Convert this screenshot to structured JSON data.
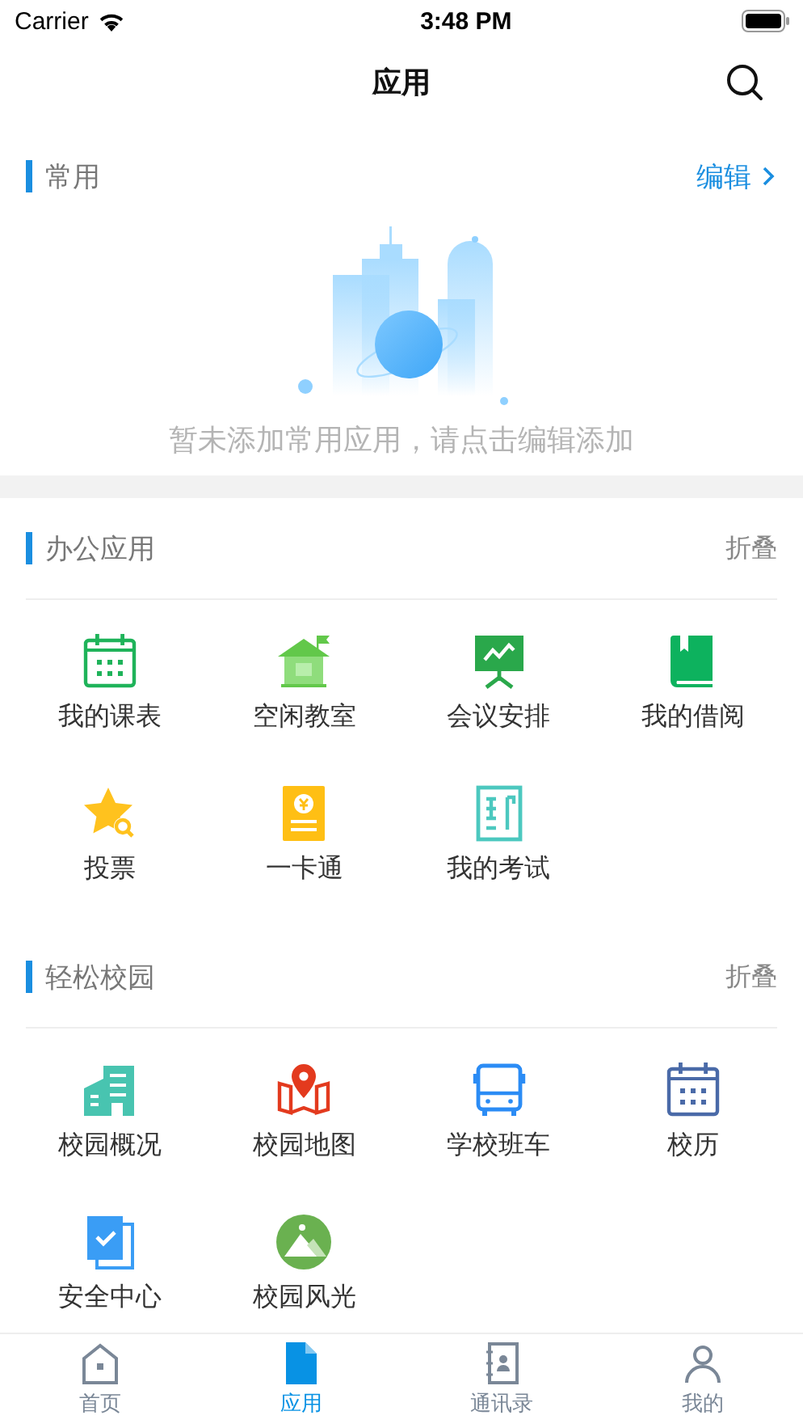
{
  "status_bar": {
    "carrier": "Carrier",
    "time": "3:48 PM"
  },
  "nav": {
    "title": "应用"
  },
  "favorites": {
    "title": "常用",
    "action": "编辑",
    "empty_text": "暂未添加常用应用，请点击编辑添加"
  },
  "sections": [
    {
      "title": "办公应用",
      "action": "折叠",
      "apps": [
        {
          "label": "我的课表",
          "kind": "calendar"
        },
        {
          "label": "空闲教室",
          "kind": "house"
        },
        {
          "label": "会议安排",
          "kind": "board"
        },
        {
          "label": "我的借阅",
          "kind": "book"
        },
        {
          "label": "投票",
          "kind": "star"
        },
        {
          "label": "一卡通",
          "kind": "card"
        },
        {
          "label": "我的考试",
          "kind": "exam"
        }
      ]
    },
    {
      "title": "轻松校园",
      "action": "折叠",
      "apps": [
        {
          "label": "校园概况",
          "kind": "building"
        },
        {
          "label": "校园地图",
          "kind": "map"
        },
        {
          "label": "学校班车",
          "kind": "bus"
        },
        {
          "label": "校历",
          "kind": "calendar-blue"
        },
        {
          "label": "安全中心",
          "kind": "check-doc"
        },
        {
          "label": "校园风光",
          "kind": "photo"
        }
      ]
    }
  ],
  "tabs": [
    {
      "label": "首页",
      "kind": "home",
      "selected": false
    },
    {
      "label": "应用",
      "kind": "apps",
      "selected": true
    },
    {
      "label": "通讯录",
      "kind": "contacts",
      "selected": false
    },
    {
      "label": "我的",
      "kind": "me",
      "selected": false
    }
  ]
}
